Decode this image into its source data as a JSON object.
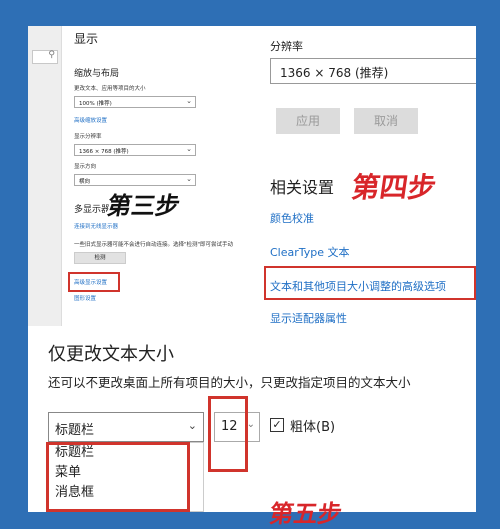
{
  "left_panel": {
    "title": "显示",
    "scale_section": "缩放与布局",
    "text_size_label": "更改文本、应用等项目的大小",
    "scale_value": "100% (推荐)",
    "advanced_scale_link": "高级缩放设置",
    "resolution_label": "显示分辨率",
    "resolution_value": "1366 × 768 (推荐)",
    "orientation_label": "显示方向",
    "orientation_value": "横向",
    "multi_display_section": "多显示器",
    "connect_wireless_link": "连接到无线显示器",
    "detect_note": "一些旧式显示器可能不会进行自动连接。选择\"检测\"即可尝试手动",
    "detect_button": "检测",
    "advanced_display_link": "高级显示设置",
    "graphics_link": "图形设置"
  },
  "right_panel": {
    "resolution_label": "分辨率",
    "resolution_value": "1366 × 768 (推荐)",
    "apply_button": "应用",
    "cancel_button": "取消",
    "related_heading": "相关设置",
    "links": [
      "颜色校准",
      "ClearType 文本",
      "文本和其他项目大小调整的高级选项",
      "显示适配器属性"
    ]
  },
  "bottom_panel": {
    "title": "仅更改文本大小",
    "description": "还可以不更改桌面上所有项目的大小，只更改指定项目的文本大小",
    "item_select_value": "标题栏",
    "size_value": "12",
    "bold_checked": "✓",
    "bold_label": "粗体(B)",
    "options": [
      "标题栏",
      "菜单",
      "消息框"
    ]
  },
  "steps": {
    "three": "第三步",
    "four": "第四步",
    "five": "第五步"
  }
}
